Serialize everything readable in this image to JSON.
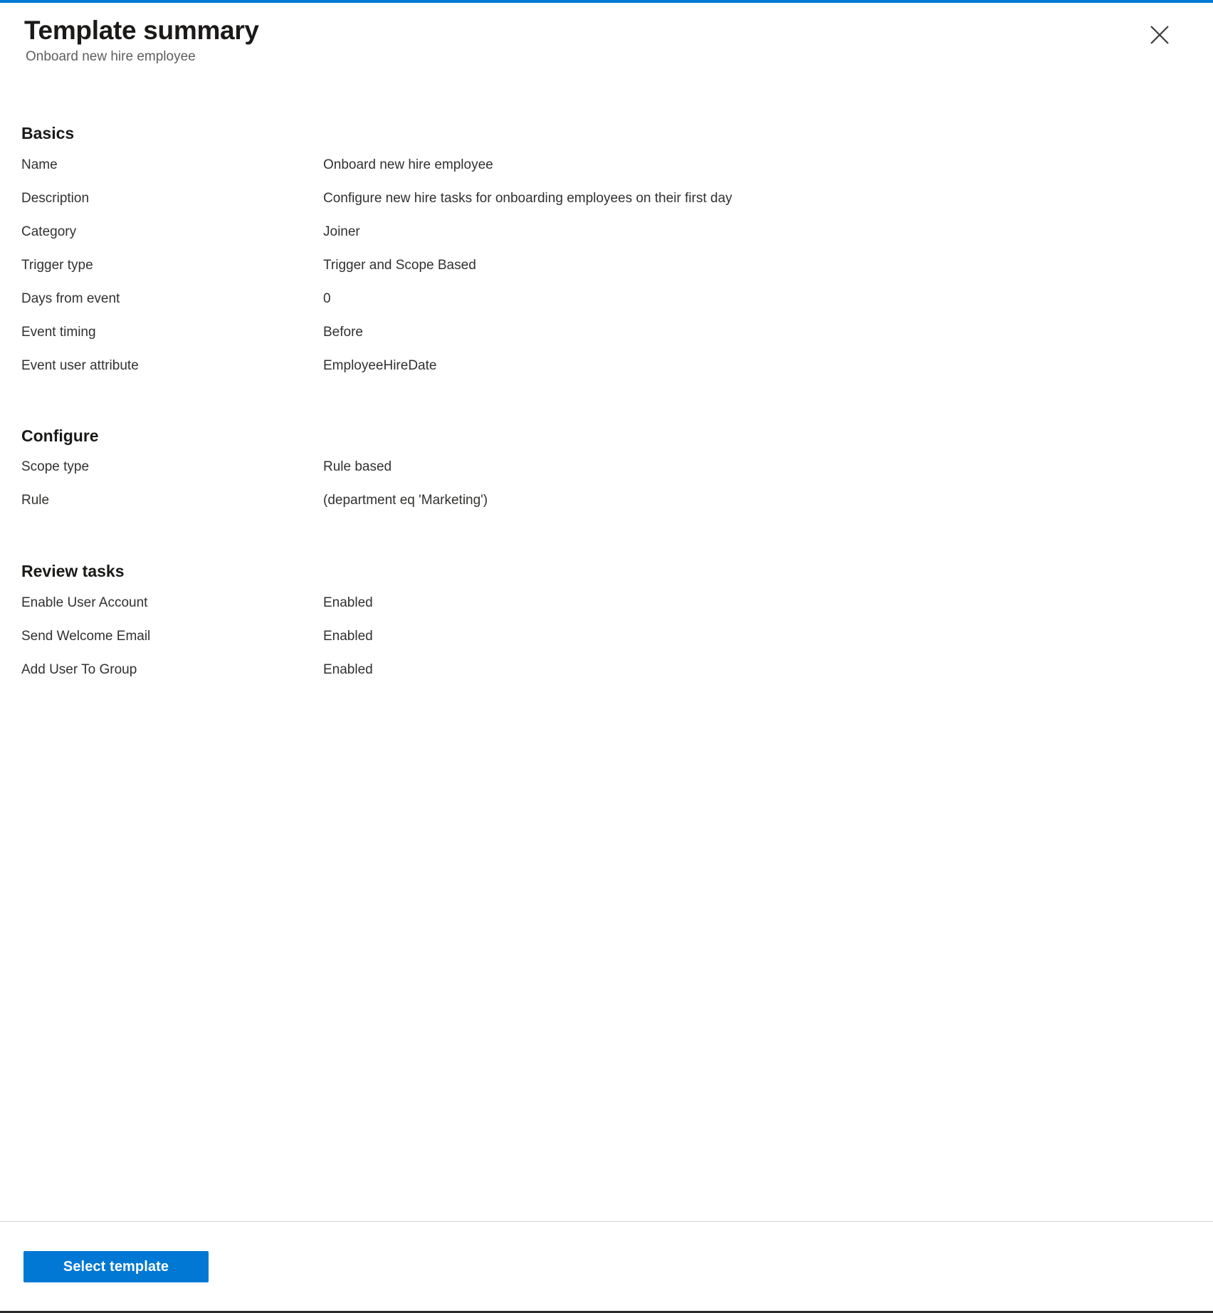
{
  "header": {
    "title": "Template summary",
    "subtitle": "Onboard new hire employee",
    "close_icon": "close-icon"
  },
  "colors": {
    "accent": "#0078d4",
    "title_text": "#1b1a19",
    "body_text": "#323130",
    "subtitle_text": "#605e5c",
    "divider": "#d6d6d6"
  },
  "sections": [
    {
      "heading": "Basics",
      "rows": [
        {
          "label": "Name",
          "value": "Onboard new hire employee"
        },
        {
          "label": "Description",
          "value": "Configure new hire tasks for onboarding employees on their first day"
        },
        {
          "label": "Category",
          "value": "Joiner"
        },
        {
          "label": "Trigger type",
          "value": "Trigger and Scope Based"
        },
        {
          "label": "Days from event",
          "value": "0"
        },
        {
          "label": "Event timing",
          "value": "Before"
        },
        {
          "label": "Event user attribute",
          "value": "EmployeeHireDate"
        }
      ]
    },
    {
      "heading": "Configure",
      "rows": [
        {
          "label": "Scope type",
          "value": "Rule based"
        },
        {
          "label": "Rule",
          "value": "(department eq 'Marketing')"
        }
      ]
    },
    {
      "heading": "Review tasks",
      "rows": [
        {
          "label": "Enable User Account",
          "value": "Enabled"
        },
        {
          "label": "Send Welcome Email",
          "value": "Enabled"
        },
        {
          "label": "Add User To Group",
          "value": "Enabled"
        }
      ]
    }
  ],
  "footer": {
    "primary_button_label": "Select template"
  }
}
